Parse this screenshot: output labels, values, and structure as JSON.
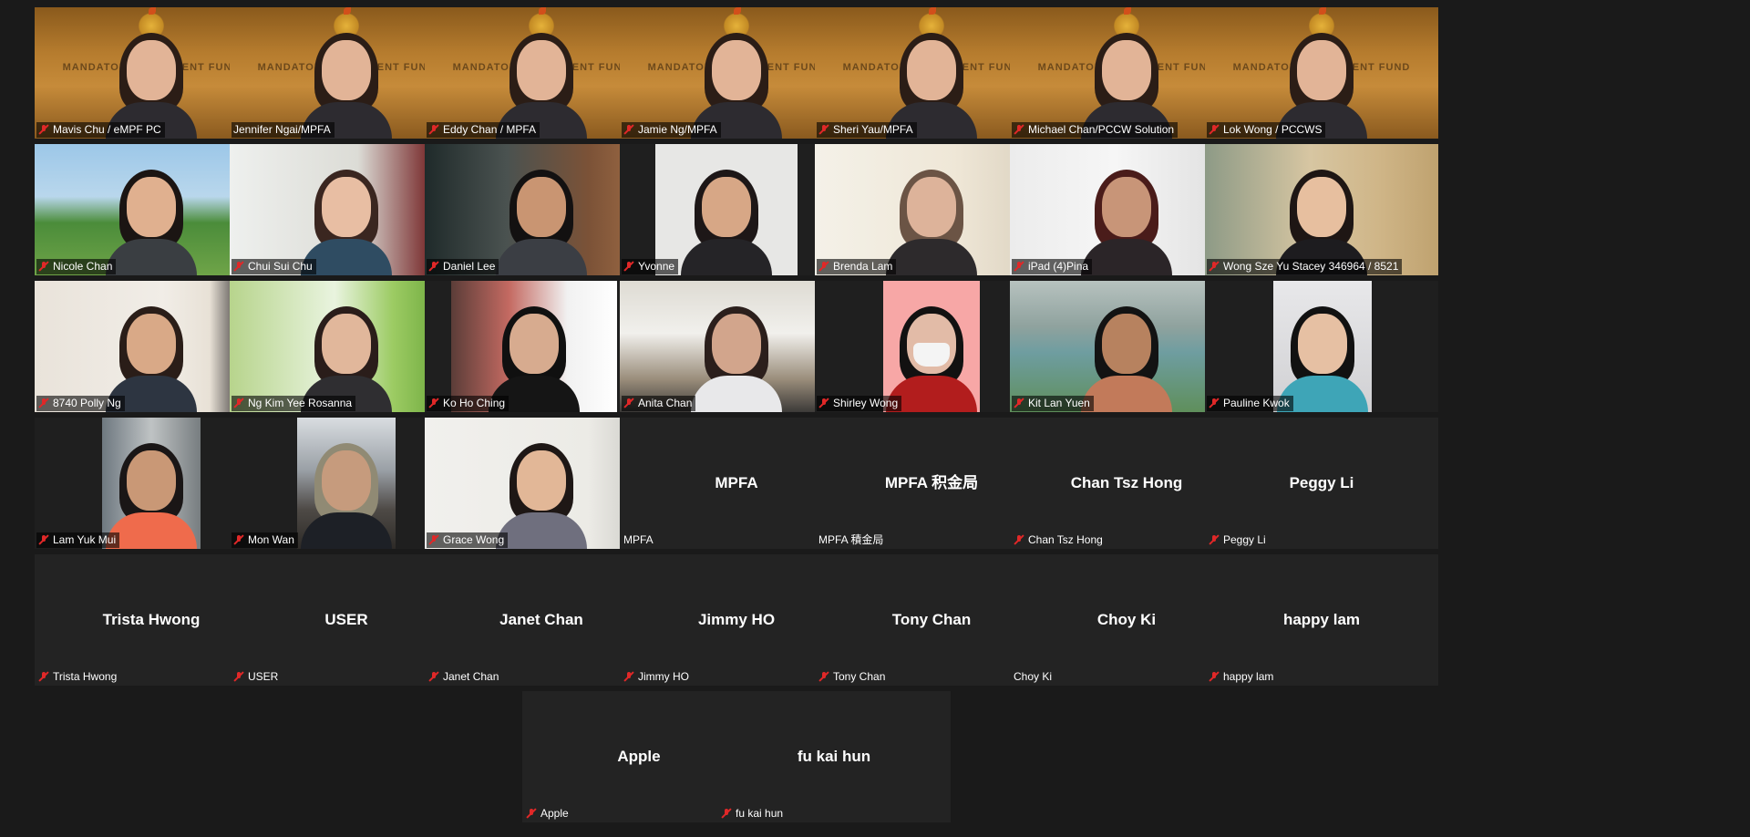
{
  "colors": {
    "background": "#1a1a1a",
    "tile": "#232323",
    "active_speaker_border": "#cde05a",
    "muted_mic": "#e02828"
  },
  "mpfa_backdrop_text": "MANDATORY PROVIDENT FUND",
  "rows": [
    [
      {
        "name": "Mavis Chu / eMPF PC",
        "muted": true,
        "video": "mpfa"
      },
      {
        "name": "Jennifer Ngai/MPFA",
        "muted": false,
        "video": "mpfa",
        "active": true
      },
      {
        "name": "Eddy Chan / MPFA",
        "muted": true,
        "video": "mpfa"
      },
      {
        "name": "Jamie Ng/MPFA",
        "muted": true,
        "video": "mpfa"
      },
      {
        "name": "Sheri Yau/MPFA",
        "muted": true,
        "video": "mpfa"
      },
      {
        "name": "Michael Chan/PCCW Solution",
        "muted": true,
        "video": "mpfa"
      },
      {
        "name": "Lok Wong / PCCWS",
        "muted": true,
        "video": "mpfa"
      }
    ],
    [
      {
        "name": "Nicole Chan",
        "muted": true,
        "video": "seaside"
      },
      {
        "name": "Chui Sui Chu",
        "muted": true,
        "video": "window"
      },
      {
        "name": "Daniel Lee",
        "muted": true,
        "video": "blur"
      },
      {
        "name": "Yvonne",
        "muted": true,
        "video": "office_narrow"
      },
      {
        "name": "Brenda Lam",
        "muted": true,
        "video": "bright"
      },
      {
        "name": "iPad (4)Pina",
        "muted": true,
        "video": "room"
      },
      {
        "name": "Wong Sze Yu Stacey 346964 / 8521",
        "muted": true,
        "video": "warm"
      }
    ],
    [
      {
        "name": "8740 Polly Ng",
        "muted": true,
        "video": "calendar"
      },
      {
        "name": "Ng Kim Yee Rosanna",
        "muted": true,
        "video": "grass"
      },
      {
        "name": "Ko Ho Ching",
        "muted": true,
        "video": "narrow_white"
      },
      {
        "name": "Anita Chan",
        "muted": true,
        "video": "office"
      },
      {
        "name": "Shirley Wong",
        "muted": true,
        "video": "pink"
      },
      {
        "name": "Kit Lan Yuen",
        "muted": true,
        "video": "harbour"
      },
      {
        "name": "Pauline Kwok",
        "muted": true,
        "video": "narrow_teal"
      }
    ],
    [
      {
        "name": "Lam Yuk Mui",
        "muted": true,
        "video": "narrow_orange"
      },
      {
        "name": "Mon Wan",
        "muted": true,
        "video": "narrow_snow"
      },
      {
        "name": "Grace Wong",
        "muted": true,
        "video": "white_room"
      },
      {
        "name": "MPFA",
        "muted": false,
        "video": "off",
        "display": "MPFA"
      },
      {
        "name": "MPFA 積金局",
        "muted": false,
        "video": "off",
        "display": "MPFA 积金局"
      },
      {
        "name": "Chan Tsz Hong",
        "muted": true,
        "video": "off",
        "display": "Chan Tsz Hong"
      },
      {
        "name": "Peggy Li",
        "muted": true,
        "video": "off",
        "display": "Peggy Li"
      }
    ],
    [
      {
        "name": "Trista Hwong",
        "muted": true,
        "video": "off",
        "display": "Trista Hwong"
      },
      {
        "name": "USER",
        "muted": true,
        "video": "off",
        "display": "USER"
      },
      {
        "name": "Janet Chan",
        "muted": true,
        "video": "off",
        "display": "Janet Chan"
      },
      {
        "name": "Jimmy HO",
        "muted": true,
        "video": "off",
        "display": "Jimmy HO"
      },
      {
        "name": "Tony Chan",
        "muted": true,
        "video": "off",
        "display": "Tony Chan"
      },
      {
        "name": "Choy Ki",
        "muted": false,
        "video": "off",
        "display": "Choy Ki"
      },
      {
        "name": "happy lam",
        "muted": true,
        "video": "off",
        "display": "happy lam"
      }
    ],
    [
      {
        "name": "Apple",
        "muted": true,
        "video": "off",
        "display": "Apple"
      },
      {
        "name": "fu kai hun",
        "muted": true,
        "video": "off",
        "display": "fu kai hun"
      }
    ]
  ]
}
